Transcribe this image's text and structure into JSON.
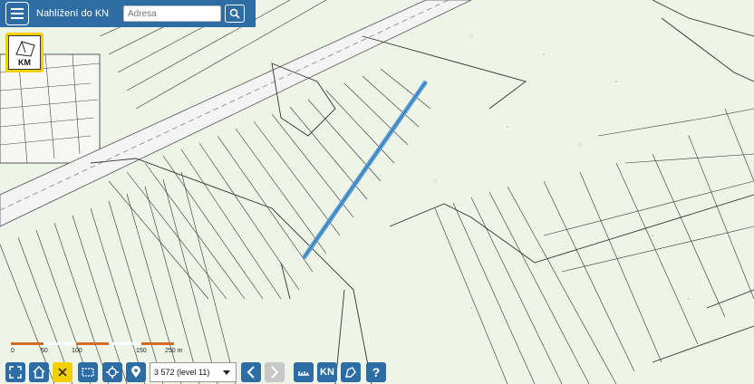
{
  "app": {
    "title": "Nahlížení do KN"
  },
  "search": {
    "placeholder": "Adresa"
  },
  "layer": {
    "label": "KM"
  },
  "scale": {
    "labels": [
      "0",
      "50",
      "100",
      "150",
      "250 m"
    ]
  },
  "zoom": {
    "value": "3 572 (level 11)"
  },
  "toolbar": {
    "kn_label": "KN",
    "help_label": "?"
  },
  "colors": {
    "accent": "#2e6da4",
    "highlight": "#f5d000",
    "map_bg": "#eef4e6",
    "selected_parcel": "#5a9fd6"
  },
  "icons": [
    "menu-icon",
    "search-icon",
    "fullscreen-icon",
    "home-icon",
    "close-icon",
    "select-area-icon",
    "locate-icon",
    "marker-icon",
    "chevron-left-icon",
    "chevron-right-icon",
    "measure-icon",
    "draw-icon",
    "help-icon"
  ]
}
